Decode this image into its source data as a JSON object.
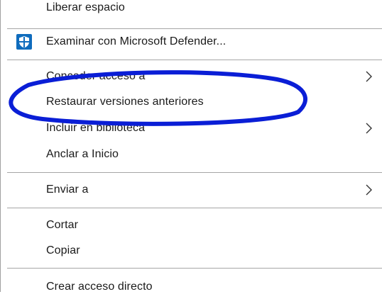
{
  "menu": {
    "items": [
      {
        "label": "Liberar espacio"
      },
      {
        "label": "Examinar con Microsoft Defender...",
        "icon": "defender-shield-icon"
      },
      {
        "label": "Conceder acceso a",
        "submenu": true
      },
      {
        "label": "Restaurar versiones anteriores",
        "highlighted_by_annotation": true
      },
      {
        "label": "Incluir en biblioteca",
        "submenu": true
      },
      {
        "label": "Anclar a Inicio"
      },
      {
        "label": "Enviar a",
        "submenu": true
      },
      {
        "label": "Cortar"
      },
      {
        "label": "Copiar"
      },
      {
        "label": "Crear acceso directo"
      }
    ]
  },
  "colors": {
    "text": "#1a1a1a",
    "separator": "#a6a6a6",
    "annotation_ellipse": "#0a1ed6",
    "defender_blue": "#0f6cbd"
  }
}
